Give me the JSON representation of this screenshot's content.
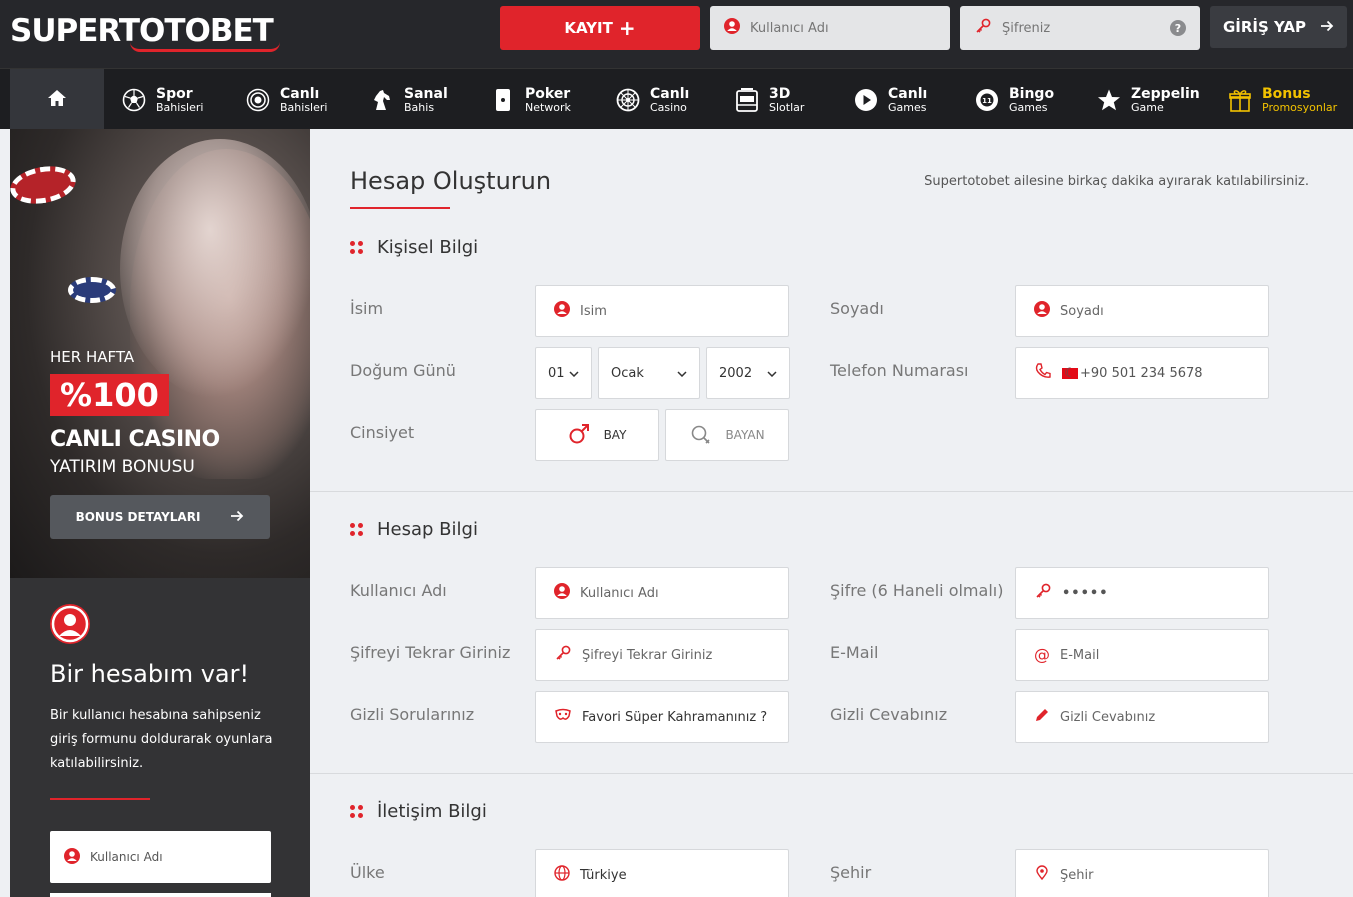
{
  "header": {
    "logo_main": "SUPERTOTO",
    "logo_accent": "BET",
    "register_label": "KAYIT",
    "register_plus": "+",
    "username_placeholder": "Kullanıcı Adı",
    "password_placeholder": "Şifreniz",
    "help_glyph": "?",
    "login_label": "GİRİŞ YAP"
  },
  "nav": {
    "items": [
      {
        "title": "Spor",
        "sub": "Bahisleri",
        "icon": "soccer-ball-icon"
      },
      {
        "title": "Canlı",
        "sub": "Bahisleri",
        "icon": "live-target-icon"
      },
      {
        "title": "Sanal",
        "sub": "Bahis",
        "icon": "horse-icon"
      },
      {
        "title": "Poker",
        "sub": "Network",
        "icon": "card-icon"
      },
      {
        "title": "Canlı",
        "sub": "Casino",
        "icon": "roulette-icon"
      },
      {
        "title": "3D",
        "sub": "Slotlar",
        "icon": "slot-machine-icon"
      },
      {
        "title": "Canlı",
        "sub": "Games",
        "icon": "play-icon"
      },
      {
        "title": "Bingo",
        "sub": "Games",
        "icon": "bingo-ball-icon"
      },
      {
        "title": "Zeppelin",
        "sub": "Game",
        "icon": "star-icon"
      },
      {
        "title": "Bonus",
        "sub": "Promosyonlar",
        "icon": "gift-icon"
      }
    ]
  },
  "promo": {
    "her_hafta": "HER HAFTA",
    "percent": "%100",
    "title": "CANLI CASINO",
    "subtitle": "YATIRIM BONUSU",
    "button": "BONUS DETAYLARI"
  },
  "account": {
    "title": "Bir hesabım var!",
    "description": "Bir kullanıcı hesabına sahipseniz giriş formunu doldurarak oyunlara katılabilirsiniz.",
    "username_placeholder": "Kullanıcı Adı"
  },
  "form": {
    "title": "Hesap Oluşturun",
    "subtitle": "Supertotobet ailesine birkaç dakika ayırarak katılabilirsiniz.",
    "personal": {
      "title": "Kişisel Bilgi",
      "name_label": "İsim",
      "name_placeholder": "Isim",
      "surname_label": "Soyadı",
      "surname_placeholder": "Soyadı",
      "birthday_label": "Doğum Günü",
      "day": "01",
      "month": "Ocak",
      "year": "2002",
      "phone_label": "Telefon Numarası",
      "phone_value": "+90 501 234 5678",
      "gender_label": "Cinsiyet",
      "male": "BAY",
      "female": "BAYAN"
    },
    "account": {
      "title": "Hesap Bilgi",
      "username_label": "Kullanıcı Adı",
      "username_placeholder": "Kullanıcı Adı",
      "password_label": "Şifre (6 Haneli olmalı)",
      "password_value": "•••••",
      "repeat_label": "Şifreyi Tekrar Giriniz",
      "repeat_placeholder": "Şifreyi Tekrar Giriniz",
      "email_label": "E-Mail",
      "email_placeholder": "E-Mail",
      "question_label": "Gizli Sorularınız",
      "question_value": "Favori Süper Kahramanınız ?",
      "answer_label": "Gizli Cevabınız",
      "answer_placeholder": "Gizli Cevabınız"
    },
    "contact": {
      "title": "İletişim Bilgi",
      "country_label": "Ülke",
      "country_value": "Türkiye",
      "city_label": "Şehir",
      "city_placeholder": "Şehir"
    }
  },
  "colors": {
    "accent": "#e0242b",
    "header_bg": "#26272b",
    "nav_bg": "#1d1e21",
    "bonus_yellow": "#f2c200"
  }
}
